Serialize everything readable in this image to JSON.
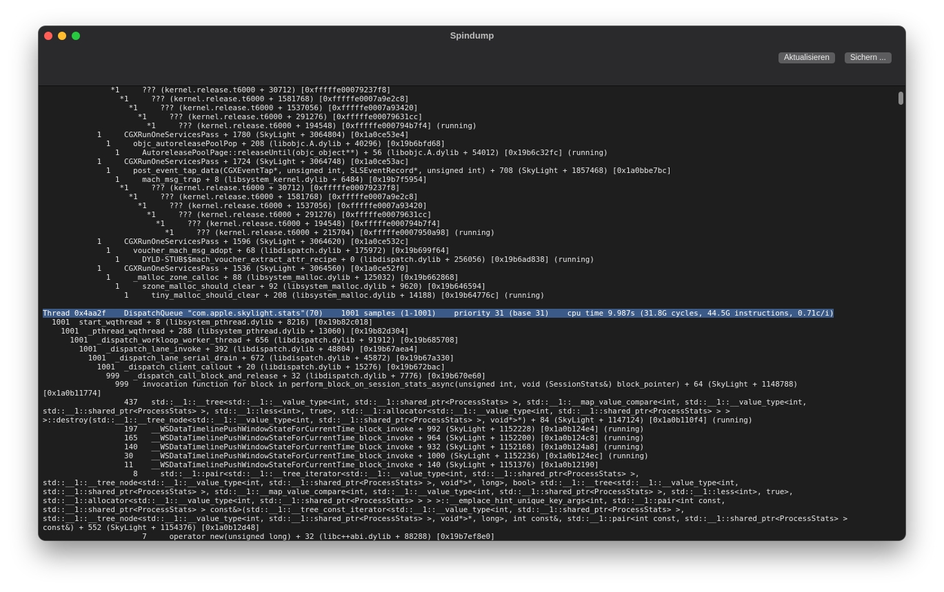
{
  "window": {
    "title": "Spindump",
    "colors": {
      "close": "#ff5f57",
      "minimize": "#febc2e",
      "maximize": "#28c840",
      "highlight": "#3b5a87"
    }
  },
  "toolbar": {
    "refresh_label": "Aktualisieren",
    "save_label": "Sichern ..."
  },
  "lines_top": [
    "               *1     ??? (kernel.release.t6000 + 30712) [0xfffffe00079237f8]",
    "                 *1     ??? (kernel.release.t6000 + 1581768) [0xfffffe0007a9e2c8]",
    "                   *1     ??? (kernel.release.t6000 + 1537056) [0xfffffe0007a93420]",
    "                     *1     ??? (kernel.release.t6000 + 291276) [0xfffffe00079631cc]",
    "                       *1     ??? (kernel.release.t6000 + 194548) [0xfffffe000794b7f4] (running)",
    "            1     CGXRunOneServicesPass + 1780 (SkyLight + 3064804) [0x1a0ce53e4]",
    "              1     objc_autoreleasePoolPop + 208 (libobjc.A.dylib + 40296) [0x19b6bfd68]",
    "                1     AutoreleasePoolPage::releaseUntil(objc_object**) + 56 (libobjc.A.dylib + 54012) [0x19b6c32fc] (running)",
    "            1     CGXRunOneServicesPass + 1724 (SkyLight + 3064748) [0x1a0ce53ac]",
    "              1     post_event_tap_data(CGXEventTap*, unsigned int, SLSEventRecord*, unsigned int) + 708 (SkyLight + 1857468) [0x1a0bbe7bc]",
    "                1     mach_msg_trap + 8 (libsystem_kernel.dylib + 6484) [0x19b7f5954]",
    "                 *1     ??? (kernel.release.t6000 + 30712) [0xfffffe00079237f8]",
    "                   *1     ??? (kernel.release.t6000 + 1581768) [0xfffffe0007a9e2c8]",
    "                     *1     ??? (kernel.release.t6000 + 1537056) [0xfffffe0007a93420]",
    "                       *1     ??? (kernel.release.t6000 + 291276) [0xfffffe00079631cc]",
    "                         *1     ??? (kernel.release.t6000 + 194548) [0xfffffe000794b7f4]",
    "                           *1     ??? (kernel.release.t6000 + 215704) [0xfffffe0007950a98] (running)",
    "            1     CGXRunOneServicesPass + 1596 (SkyLight + 3064620) [0x1a0ce532c]",
    "              1     voucher_mach_msg_adopt + 68 (libdispatch.dylib + 175972) [0x19b699f64]",
    "                1     DYLD-STUB$$mach_voucher_extract_attr_recipe + 0 (libdispatch.dylib + 256056) [0x19b6ad838] (running)",
    "            1     CGXRunOneServicesPass + 1536 (SkyLight + 3064560) [0x1a0ce52f0]",
    "              1     _malloc_zone_calloc + 88 (libsystem_malloc.dylib + 125032) [0x19b662868]",
    "                1     szone_malloc_should_clear + 92 (libsystem_malloc.dylib + 9620) [0x19b646594]",
    "                  1     tiny_malloc_should_clear + 208 (libsystem_malloc.dylib + 14188) [0x19b64776c] (running)",
    ""
  ],
  "thread_header": "Thread 0x4aa2f    DispatchQueue \"com.apple.skylight.stats\"(70)    1001 samples (1-1001)    priority 31 (base 31)    cpu time 9.987s (31.8G cycles, 44.5G instructions, 0.71c/i)",
  "lines_bottom": [
    "  1001  start_wqthread + 8 (libsystem_pthread.dylib + 8216) [0x19b82c018]",
    "    1001  _pthread_wqthread + 288 (libsystem_pthread.dylib + 13060) [0x19b82d304]",
    "      1001  _dispatch_workloop_worker_thread + 656 (libdispatch.dylib + 91912) [0x19b685708]",
    "        1001  _dispatch_lane_invoke + 392 (libdispatch.dylib + 48804) [0x19b67aea4]",
    "          1001  _dispatch_lane_serial_drain + 672 (libdispatch.dylib + 45872) [0x19b67a330]",
    "            1001  _dispatch_client_callout + 20 (libdispatch.dylib + 15276) [0x19b672bac]",
    "              999   _dispatch_call_block_and_release + 32 (libdispatch.dylib + 7776) [0x19b670e60]",
    "                999   invocation function for block in perform_block_on_session_stats_async(unsigned int, void (SessionStats&) block_pointer) + 64 (SkyLight + 1148788)",
    "[0x1a0b11774]",
    "                  437   std::__1::__tree<std::__1::__value_type<int, std::__1::shared_ptr<ProcessStats> >, std::__1::__map_value_compare<int, std::__1::__value_type<int,",
    "std::__1::shared_ptr<ProcessStats> >, std::__1::less<int>, true>, std::__1::allocator<std::__1::__value_type<int, std::__1::shared_ptr<ProcessStats> > >",
    ">::destroy(std::__1::__tree_node<std::__1::__value_type<int, std::__1::shared_ptr<ProcessStats> >, void*>*) + 84 (SkyLight + 1147124) [0x1a0b110f4] (running)",
    "                  197   __WSDataTimelinePushWindowStateForCurrentTime_block_invoke + 992 (SkyLight + 1152228) [0x1a0b124e4] (running)",
    "                  165   __WSDataTimelinePushWindowStateForCurrentTime_block_invoke + 964 (SkyLight + 1152200) [0x1a0b124c8] (running)",
    "                  140   __WSDataTimelinePushWindowStateForCurrentTime_block_invoke + 932 (SkyLight + 1152168) [0x1a0b124a8] (running)",
    "                  30    __WSDataTimelinePushWindowStateForCurrentTime_block_invoke + 1000 (SkyLight + 1152236) [0x1a0b124ec] (running)",
    "                  11    __WSDataTimelinePushWindowStateForCurrentTime_block_invoke + 140 (SkyLight + 1151376) [0x1a0b12190]",
    "                    8     std::__1::pair<std::__1::__tree_iterator<std::__1::__value_type<int, std::__1::shared_ptr<ProcessStats> >,",
    "std::__1::__tree_node<std::__1::__value_type<int, std::__1::shared_ptr<ProcessStats> >, void*>*, long>, bool> std::__1::__tree<std::__1::__value_type<int,",
    "std::__1::shared_ptr<ProcessStats> >, std::__1::__map_value_compare<int, std::__1::__value_type<int, std::__1::shared_ptr<ProcessStats> >, std::__1::less<int>, true>,",
    "std::__1::allocator<std::__1::__value_type<int, std::__1::shared_ptr<ProcessStats> > > >::__emplace_hint_unique_key_args<int, std::__1::pair<int const,",
    "std::__1::shared_ptr<ProcessStats> > const&>(std::__1::__tree_const_iterator<std::__1::__value_type<int, std::__1::shared_ptr<ProcessStats> >,",
    "std::__1::__tree_node<std::__1::__value_type<int, std::__1::shared_ptr<ProcessStats> >, void*>*, long>, int const&, std::__1::pair<int const, std::__1::shared_ptr<ProcessStats> >",
    "const&) + 552 (SkyLight + 1154376) [0x1a0b12d48]",
    "                      7     operator new(unsigned long) + 32 (libc++abi.dylib + 88288) [0x19b7ef8e0]"
  ]
}
